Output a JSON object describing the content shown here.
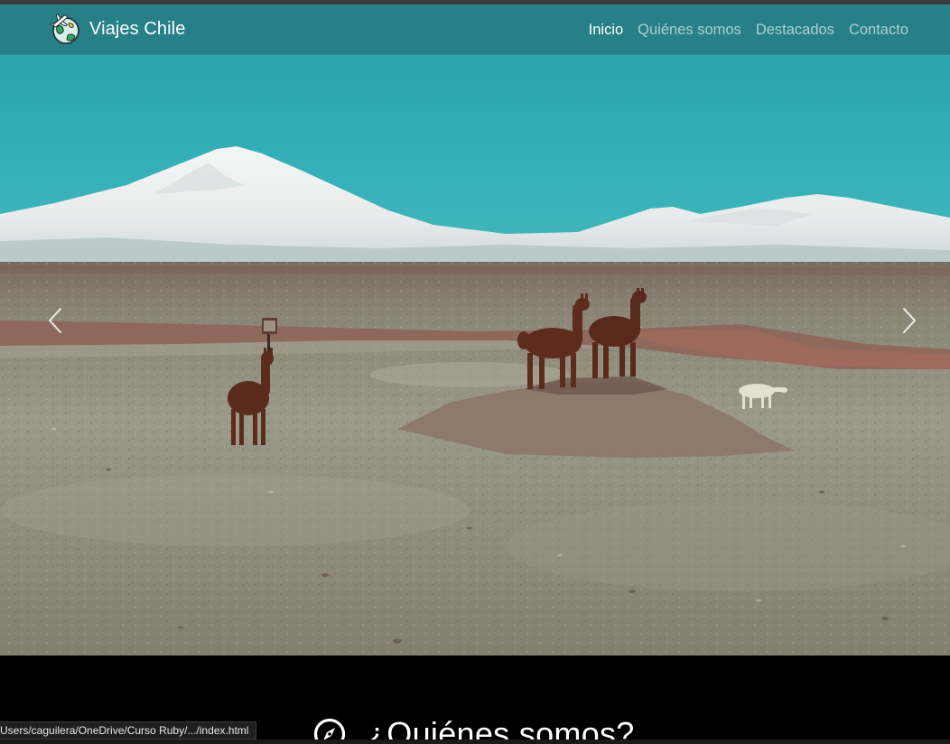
{
  "navbar": {
    "brand": "Viajes Chile",
    "links": [
      {
        "label": "Inicio",
        "active": true
      },
      {
        "label": "Quiénes somos",
        "active": false
      },
      {
        "label": "Destacados",
        "active": false
      },
      {
        "label": "Contacto",
        "active": false
      }
    ]
  },
  "carousel": {
    "prev_icon": "chevron-left-icon",
    "next_icon": "chevron-right-icon"
  },
  "about": {
    "icon": "compass-icon",
    "title": "¿Quiénes somos?"
  },
  "status_bar": {
    "url": "Users/caguilera/OneDrive/Curso Ruby/.../index.html"
  },
  "colors": {
    "navbar_bg": "#26767e",
    "sky": "#2ba6b0",
    "ground": "#8f8e7e",
    "page_bg": "#000000"
  }
}
